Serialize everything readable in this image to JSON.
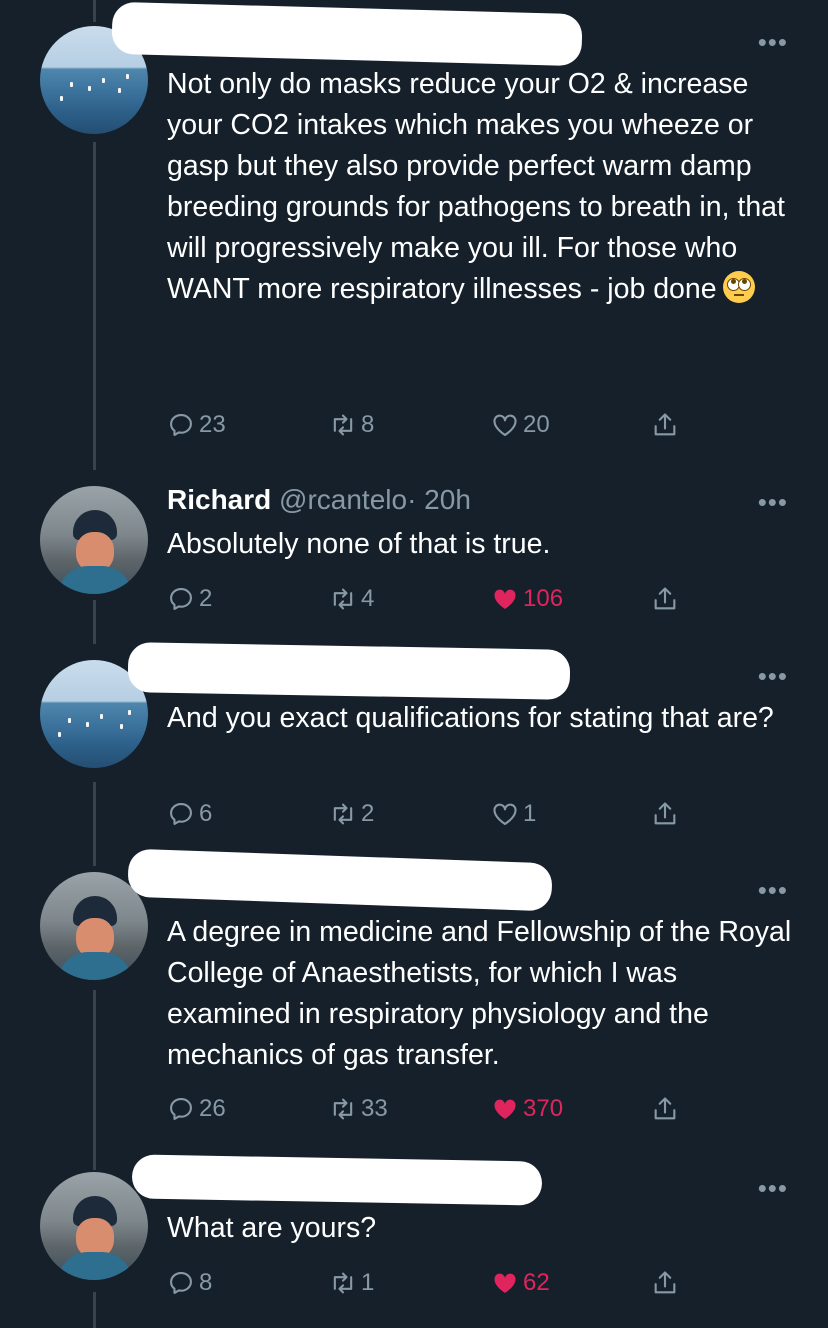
{
  "tweets": [
    {
      "author_name": "",
      "handle": "",
      "time": "",
      "text": "Not only do masks reduce your O2 & increase your CO2 intakes which makes you wheeze or gasp but they also provide perfect warm damp breeding grounds for pathogens to breath in, that will progressively make you ill. For those who WANT more respiratory illnesses - job done",
      "emoji": "face-with-rolling-eyes",
      "replies": "23",
      "retweets": "8",
      "likes": "20",
      "liked": false,
      "avatar": "sea-avatar"
    },
    {
      "author_name": "Richard",
      "handle": "@rcantelo",
      "time": "· 20h",
      "text": "Absolutely none of that is true.",
      "replies": "2",
      "retweets": "4",
      "likes": "106",
      "liked": true,
      "avatar": "man-avatar"
    },
    {
      "author_name": "",
      "handle": "",
      "time": "",
      "text": "And you exact qualifications for stating that are?",
      "replies": "6",
      "retweets": "2",
      "likes": "1",
      "liked": false,
      "avatar": "sea-avatar"
    },
    {
      "author_name": "",
      "handle": "",
      "time": "",
      "text": "A degree in medicine and Fellowship of the Royal College of Anaesthetists, for which I was examined in respiratory physiology and the mechanics of gas transfer.",
      "replies": "26",
      "retweets": "33",
      "likes": "370",
      "liked": true,
      "avatar": "man-avatar"
    },
    {
      "author_name": "",
      "handle": "",
      "time": "",
      "text": "What are yours?",
      "replies": "8",
      "retweets": "1",
      "likes": "62",
      "liked": true,
      "avatar": "man-avatar"
    }
  ],
  "more_glyph": "•••",
  "colors": {
    "background": "#15202b",
    "muted": "#8899a6",
    "like": "#e0245e",
    "thread_line": "#38444d"
  }
}
